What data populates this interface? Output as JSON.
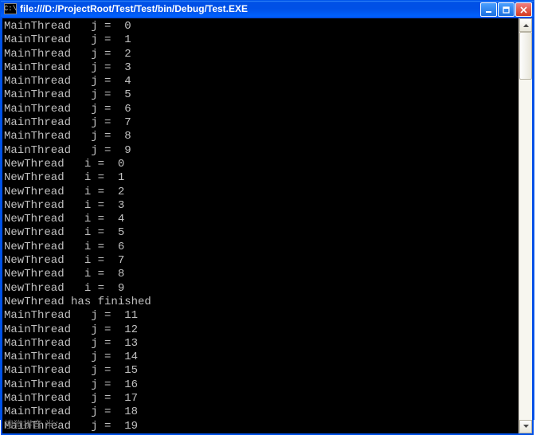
{
  "window": {
    "icon_text": "C:\\",
    "title": "file:///D:/ProjectRoot/Test/Test/bin/Debug/Test.EXE"
  },
  "console": {
    "lines": [
      "MainThread   j =  0",
      "MainThread   j =  1",
      "MainThread   j =  2",
      "MainThread   j =  3",
      "MainThread   j =  4",
      "MainThread   j =  5",
      "MainThread   j =  6",
      "MainThread   j =  7",
      "MainThread   j =  8",
      "MainThread   j =  9",
      "NewThread   i =  0",
      "NewThread   i =  1",
      "NewThread   i =  2",
      "NewThread   i =  3",
      "NewThread   i =  4",
      "NewThread   i =  5",
      "NewThread   i =  6",
      "NewThread   i =  7",
      "NewThread   i =  8",
      "NewThread   i =  9",
      "NewThread has finished",
      "MainThread   j =  11",
      "MainThread   j =  12",
      "MainThread   j =  13",
      "MainThread   j =  14",
      "MainThread   j =  15",
      "MainThread   j =  16",
      "MainThread   j =  17",
      "MainThread   j =  18",
      "MainThread   j =  19"
    ]
  },
  "ime": {
    "text": "搜狗拼音  半："
  }
}
